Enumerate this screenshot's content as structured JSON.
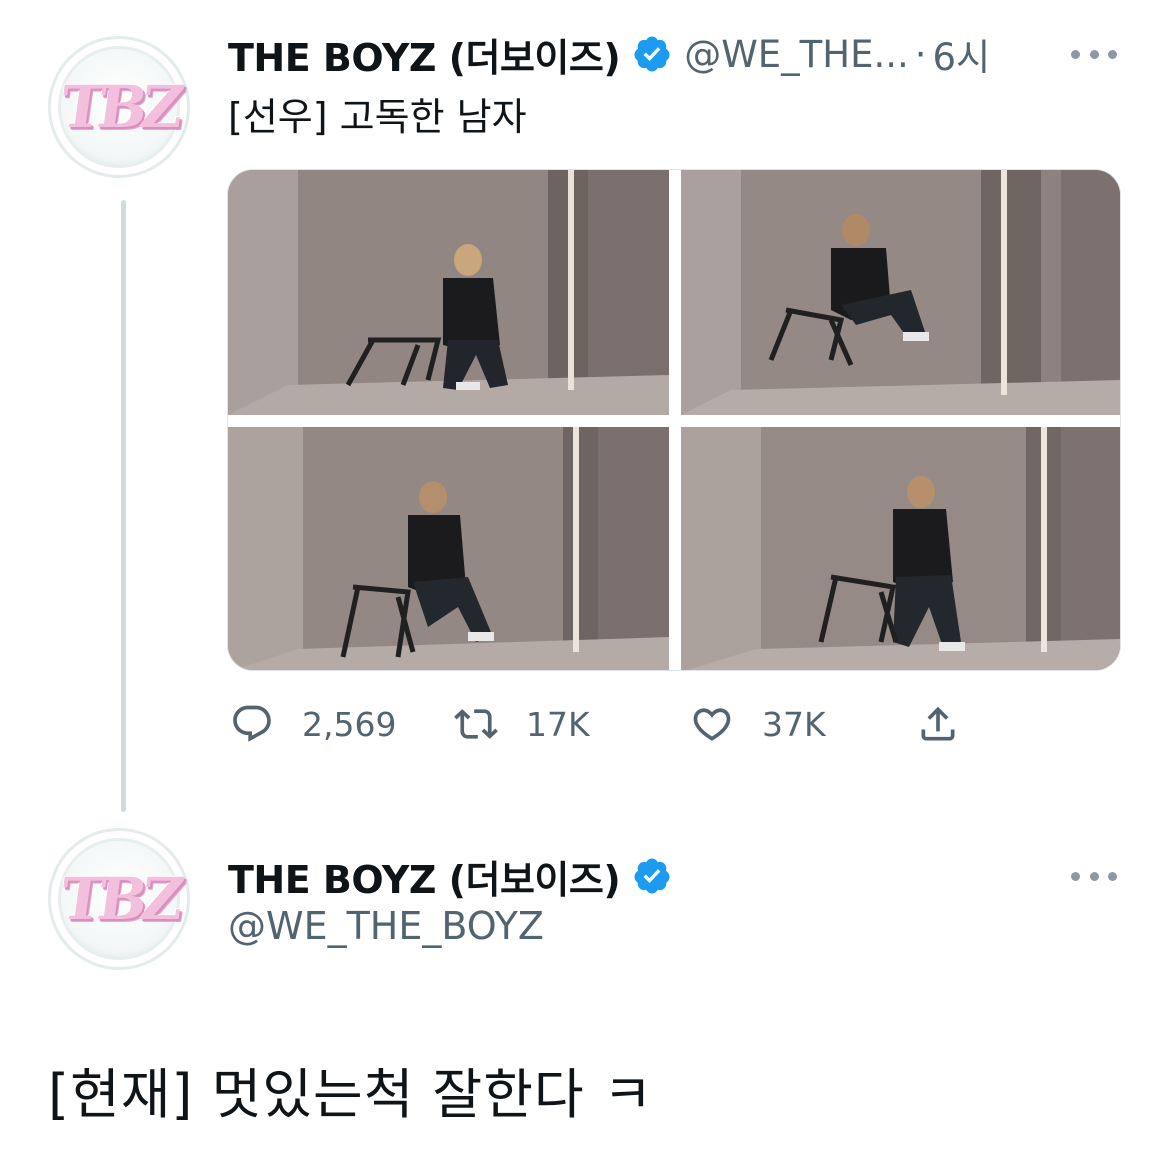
{
  "tweet1": {
    "display_name": "THE BOYZ (더보이즈)",
    "handle": "@WE_THE...",
    "separator": "·",
    "time": "6시",
    "text": "[선우] 고독한 남자",
    "avatar_logo": "TBZ",
    "photos": [
      "photo-1",
      "photo-2",
      "photo-3",
      "photo-4"
    ],
    "actions": {
      "reply_count": "2,569",
      "retweet_count": "17K",
      "like_count": "37K"
    }
  },
  "tweet2": {
    "display_name": "THE BOYZ (더보이즈)",
    "handle": "@WE_THE_BOYZ",
    "avatar_logo": "TBZ",
    "text": "[현재] 멋있는척 잘한다 ㅋ"
  },
  "colors": {
    "verified": "#1d9bf0",
    "secondary_text": "#536471",
    "thread_line": "#cfd9de"
  },
  "icons": [
    "verified-badge-icon",
    "more-icon",
    "reply-icon",
    "retweet-icon",
    "like-icon",
    "share-icon"
  ]
}
